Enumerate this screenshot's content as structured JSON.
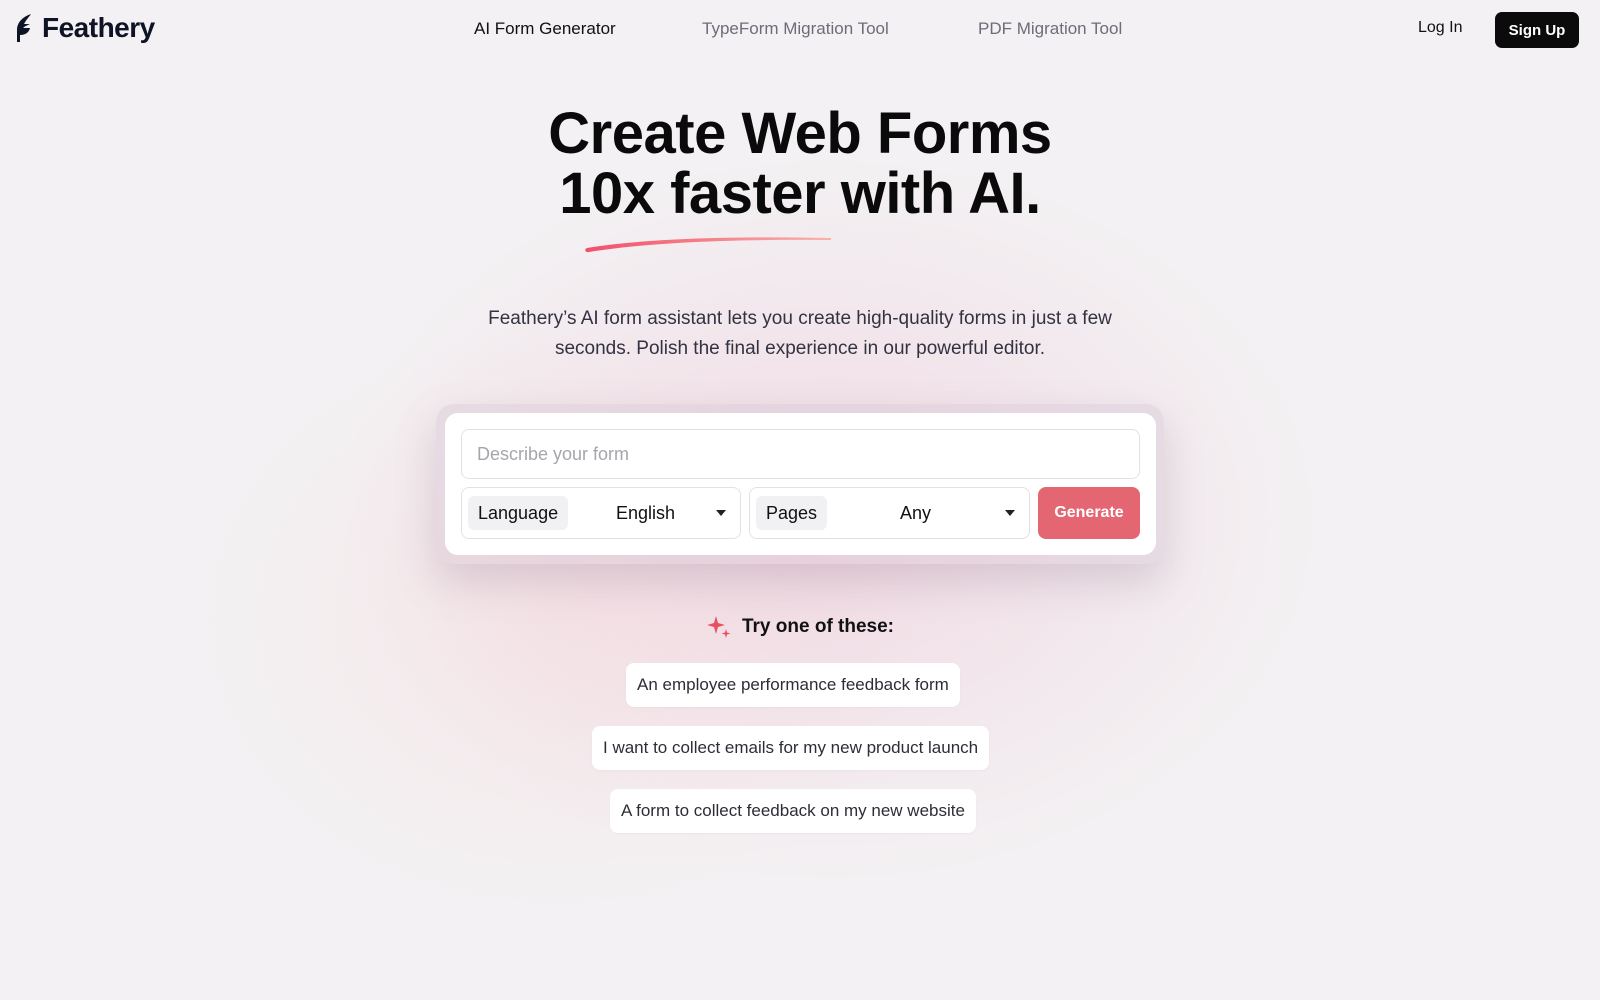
{
  "brand": {
    "name": "Feathery",
    "logo_icon": "feather-logo-icon"
  },
  "nav": {
    "items": [
      {
        "label": "AI Form Generator",
        "active": true
      },
      {
        "label": "TypeForm Migration Tool",
        "active": false
      },
      {
        "label": "PDF Migration Tool",
        "active": false
      }
    ],
    "login_label": "Log In",
    "signup_label": "Sign Up"
  },
  "hero": {
    "title_line1": "Create Web Forms",
    "title_line2": "10x faster with AI.",
    "subtitle_line1": "Feathery’s AI form assistant lets you create high-quality forms in just a few",
    "subtitle_line2": "seconds. Polish the final experience in our powerful editor."
  },
  "form": {
    "describe_placeholder": "Describe your form",
    "describe_value": "",
    "language": {
      "label": "Language",
      "value": "English"
    },
    "pages": {
      "label": "Pages",
      "value": "Any"
    },
    "generate_label": "Generate"
  },
  "suggestions": {
    "heading": "Try one of these:",
    "icon": "sparkle-icon",
    "items": [
      "An employee performance feedback form",
      "I want to collect emails for my new product launch",
      "A form to collect feedback on my new website"
    ]
  },
  "colors": {
    "accent": "#e46672",
    "swash_start": "#f24f6b",
    "swash_end": "#f7b3a8",
    "signup_bg": "#0b0b0b",
    "text": "#0a0a0a"
  }
}
